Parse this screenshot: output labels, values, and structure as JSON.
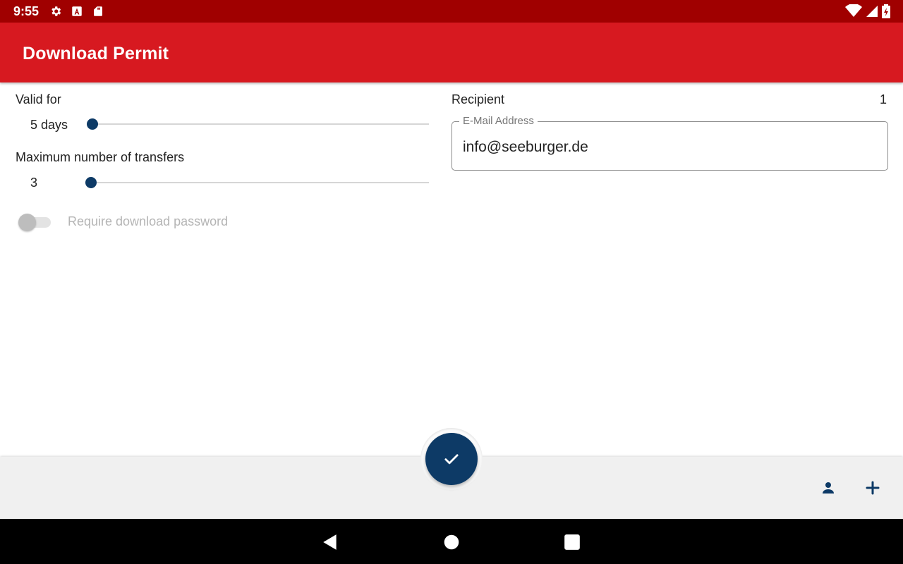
{
  "status_bar": {
    "time": "9:55",
    "icons": [
      "gear-icon",
      "a-icon",
      "sd-card-icon",
      "wifi-icon",
      "signal-icon",
      "battery-icon"
    ]
  },
  "app_bar": {
    "title": "Download Permit",
    "color": "#d71920"
  },
  "valid_for": {
    "label": "Valid for",
    "value_text": "5 days",
    "slider_fraction": 0.0
  },
  "max_transfers": {
    "label": "Maximum number of transfers",
    "value_text": "3",
    "slider_fraction": 0.0
  },
  "password_toggle": {
    "label": "Require download password",
    "checked": false,
    "enabled": false
  },
  "recipient": {
    "label": "Recipient",
    "count": "1",
    "email_legend": "E-Mail Address",
    "email_value": "info@seeburger.de"
  },
  "bottom_bar": {
    "fab_icon": "check-icon",
    "actions": [
      "person-icon",
      "add-icon"
    ]
  },
  "nav_bar": {
    "buttons": [
      "back-icon",
      "home-icon",
      "recents-icon"
    ]
  },
  "colors": {
    "accent": "#0d3a66",
    "status_bar": "#a00000"
  }
}
